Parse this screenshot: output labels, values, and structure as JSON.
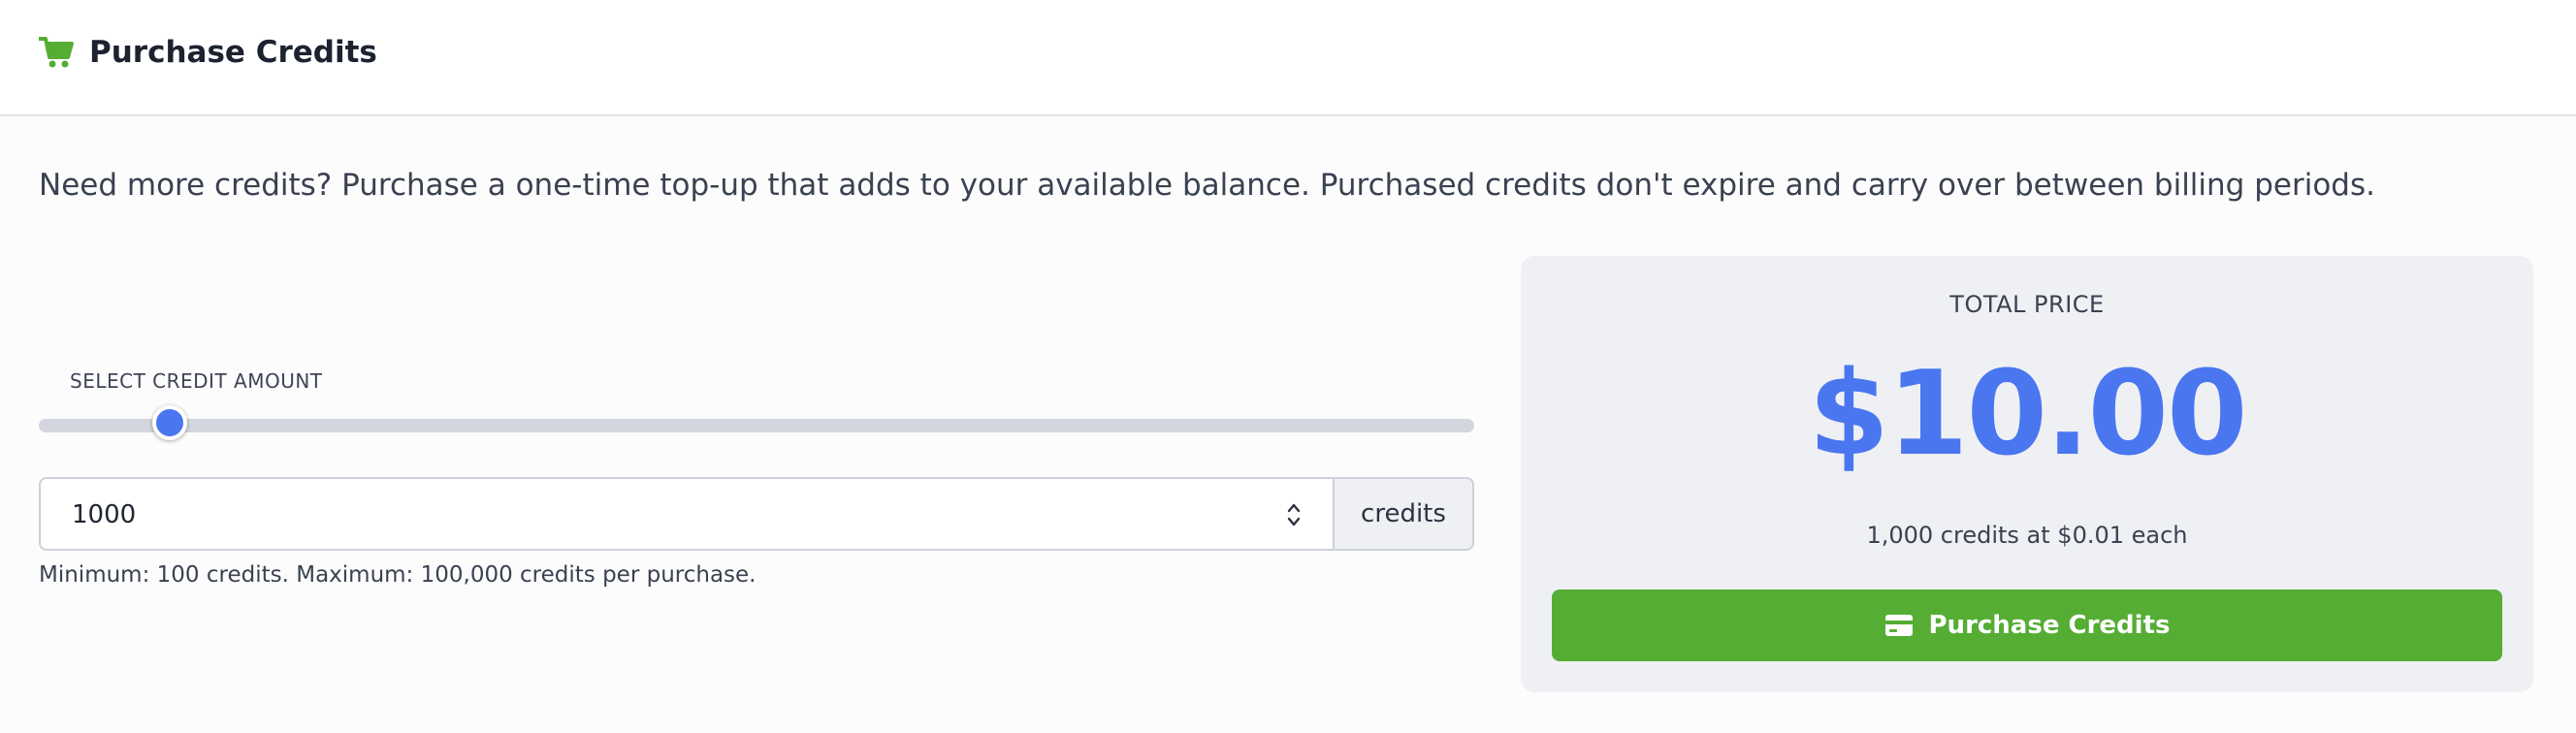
{
  "header": {
    "icon": "shopping-cart-icon",
    "title": "Purchase Credits"
  },
  "description": "Need more credits? Purchase a one-time top-up that adds to your available balance. Purchased credits don't expire and carry over between billing periods.",
  "slider": {
    "label": "SELECT CREDIT AMOUNT",
    "value": 1000,
    "min": 100,
    "max": 10000
  },
  "amount_input": {
    "value": "1000",
    "unit": "credits",
    "helper": "Minimum: 100 credits. Maximum: 100,000 credits per purchase."
  },
  "price": {
    "label": "TOTAL PRICE",
    "amount": "$10.00",
    "detail": "1,000 credits at $0.01 each"
  },
  "purchase_button": {
    "icon": "credit-card-icon",
    "label": "Purchase Credits"
  },
  "colors": {
    "brand_green": "#55ad34",
    "accent_blue": "#4a76f0",
    "panel_bg": "#eff0f4",
    "track": "#d3d6de"
  }
}
